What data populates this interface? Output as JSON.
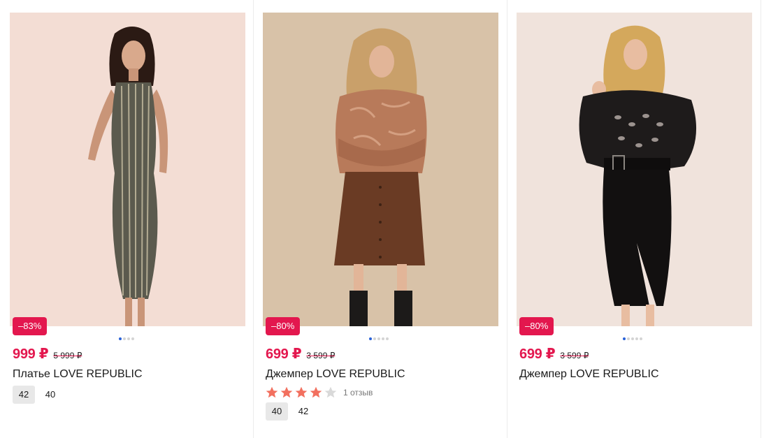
{
  "products": [
    {
      "discount": "–83%",
      "price": "999 ₽",
      "old_price": "5 999 ₽",
      "title": "Платье LOVE REPUBLIC",
      "sizes": [
        "42",
        "40"
      ],
      "image_dots": 4,
      "active_dot": 0
    },
    {
      "discount": "–80%",
      "price": "699 ₽",
      "old_price": "3 599 ₽",
      "title": "Джемпер LOVE REPUBLIC",
      "rating": 4,
      "rating_max": 5,
      "reviews": "1 отзыв",
      "sizes": [
        "40",
        "42"
      ],
      "image_dots": 5,
      "active_dot": 0
    },
    {
      "discount": "–80%",
      "price": "699 ₽",
      "old_price": "3 599 ₽",
      "title": "Джемпер LOVE REPUBLIC",
      "image_dots": 5,
      "active_dot": 0
    }
  ],
  "colors": {
    "accent": "#e3174e",
    "star_filled": "#f2705f",
    "star_empty": "#d9d9d9",
    "dot_active": "#2a62d8"
  }
}
